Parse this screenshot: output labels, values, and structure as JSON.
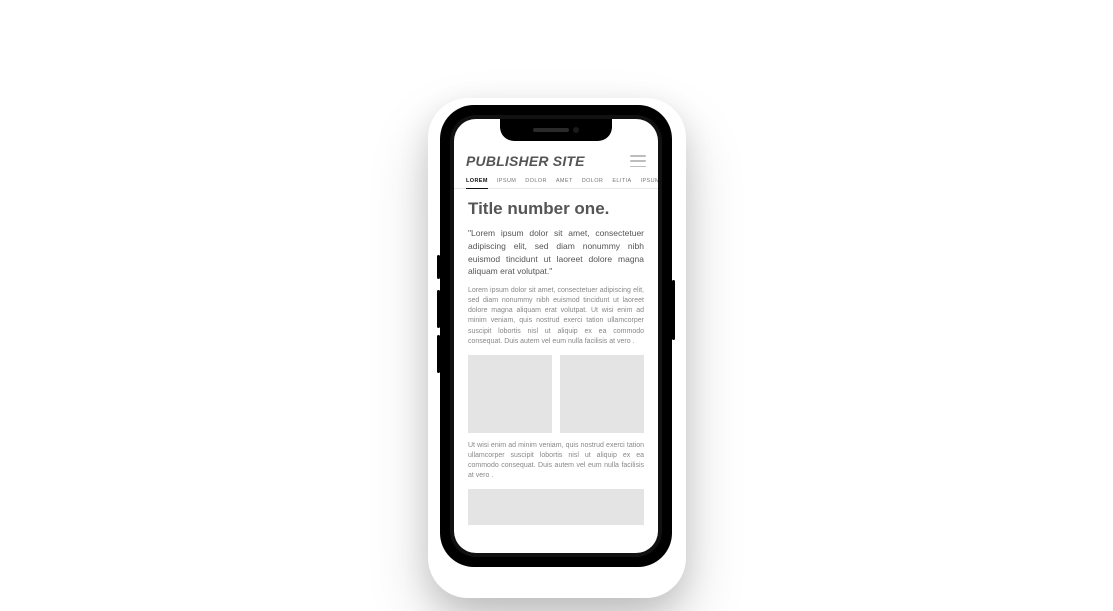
{
  "site": {
    "title": "PUBLISHER SITE"
  },
  "nav": {
    "tabs": [
      {
        "label": "LOREM",
        "active": true
      },
      {
        "label": "IPSUM",
        "active": false
      },
      {
        "label": "DOLOR",
        "active": false
      },
      {
        "label": "AMET",
        "active": false
      },
      {
        "label": "DOLOR",
        "active": false
      },
      {
        "label": "ELITIA",
        "active": false
      },
      {
        "label": "IPSUM",
        "active": false
      }
    ]
  },
  "article": {
    "title": "Title number one.",
    "lead": "\"Lorem ipsum dolor sit amet, consectetuer adipiscing elit, sed diam nonummy nibh euismod tincidunt ut laoreet dolore magna aliquam erat volutpat.\"",
    "body1": "Lorem ipsum dolor sit amet, consectetuer adipiscing elit, sed diam nonummy nibh euismod tincidunt ut laoreet dolore magna aliquam erat volutpat. Ut wisi enim ad minim veniam, quis nostrud exerci tation ullamcorper suscipit lobortis nisl ut aliquip ex ea commodo consequat. Duis autem vel eum nulla facilisis at vero .",
    "body2": "Ut wisi enim ad minim veniam, quis nostrud exerci tation ullamcorper suscipit lobortis nisl ut aliquip ex ea commodo consequat. Duis autem vel eum nulla facilisis at vero ."
  }
}
